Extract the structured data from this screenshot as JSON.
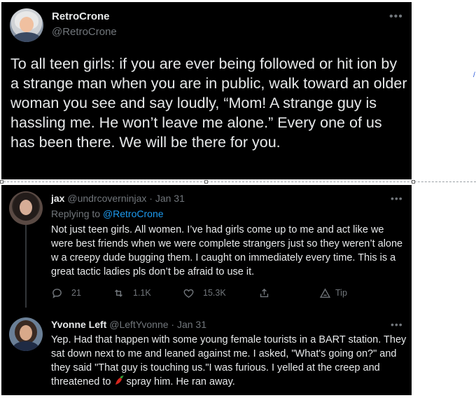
{
  "main_tweet": {
    "display_name": "RetroCrone",
    "handle": "@RetroCrone",
    "more_icon": "•••",
    "text": "To all teen girls:  if you are ever being followed or hit ion by a strange man when you are in public, walk toward an older woman you see and say loudly, “Mom!  A strange guy is hassling me. He won’t leave me alone.” Every one of us has been there. We will be there for you."
  },
  "reply_1": {
    "display_name": "jax",
    "handle": "@undrcoverninjax",
    "date": "· Jan 31",
    "more_icon": "•••",
    "replying_prefix": "Replying to",
    "replying_to": "@RetroCrone",
    "text": "Not just teen girls. All women. I’ve had girls come up to me and act like we were best friends when we were complete strangers just so they weren’t alone w a creepy dude bugging them. I caught on immediately every time. This is a great tactic ladies pls don’t be afraid to use it.",
    "actions": {
      "replies": "21",
      "retweets": "1.1K",
      "likes": "15.3K",
      "tip": "Tip"
    }
  },
  "reply_2": {
    "display_name": "Yvonne Left",
    "handle": "@LeftYvonne",
    "date": "· Jan 31",
    "more_icon": "•••",
    "text_before_emoji": "Yep. Had that happen with some young female tourists in a BART station. They sat down next to me and leaned against me. I asked, \"What's going on?\" and they said \"That guy is touching us.\"I was furious. I yelled at the creep and threatened to",
    "emoji": "hot-pepper",
    "text_after_emoji": "spray him. He ran away."
  },
  "colors": {
    "background": "#000000",
    "text": "#e7e9ea",
    "muted": "#71767b",
    "accent": "#1d9bf0"
  }
}
